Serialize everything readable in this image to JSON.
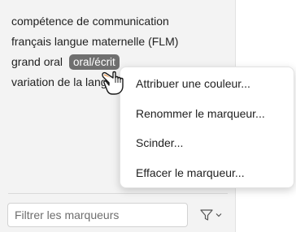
{
  "tags": {
    "items": [
      {
        "label": "compétence de communication"
      },
      {
        "label": "français langue maternelle (FLM)"
      },
      {
        "label": "grand oral",
        "chip": "oral/écrit"
      },
      {
        "label": "variation de la langue"
      }
    ]
  },
  "context_menu": {
    "items": [
      {
        "label": "Attribuer une couleur..."
      },
      {
        "label": "Renommer le marqueur..."
      },
      {
        "label": "Scinder..."
      },
      {
        "label": "Effacer le marqueur..."
      }
    ]
  },
  "filter": {
    "placeholder": "Filtrer les marqueurs",
    "value": ""
  },
  "icons": {
    "filter": "filter-funnel-icon",
    "chevron": "chevron-down-icon",
    "cursor": "hand-pointer-icon"
  },
  "colors": {
    "panel_bg": "#f3f3f3",
    "chip_bg": "#6f6f6f",
    "menu_bg": "#ffffff",
    "text": "#1f1f1f"
  }
}
